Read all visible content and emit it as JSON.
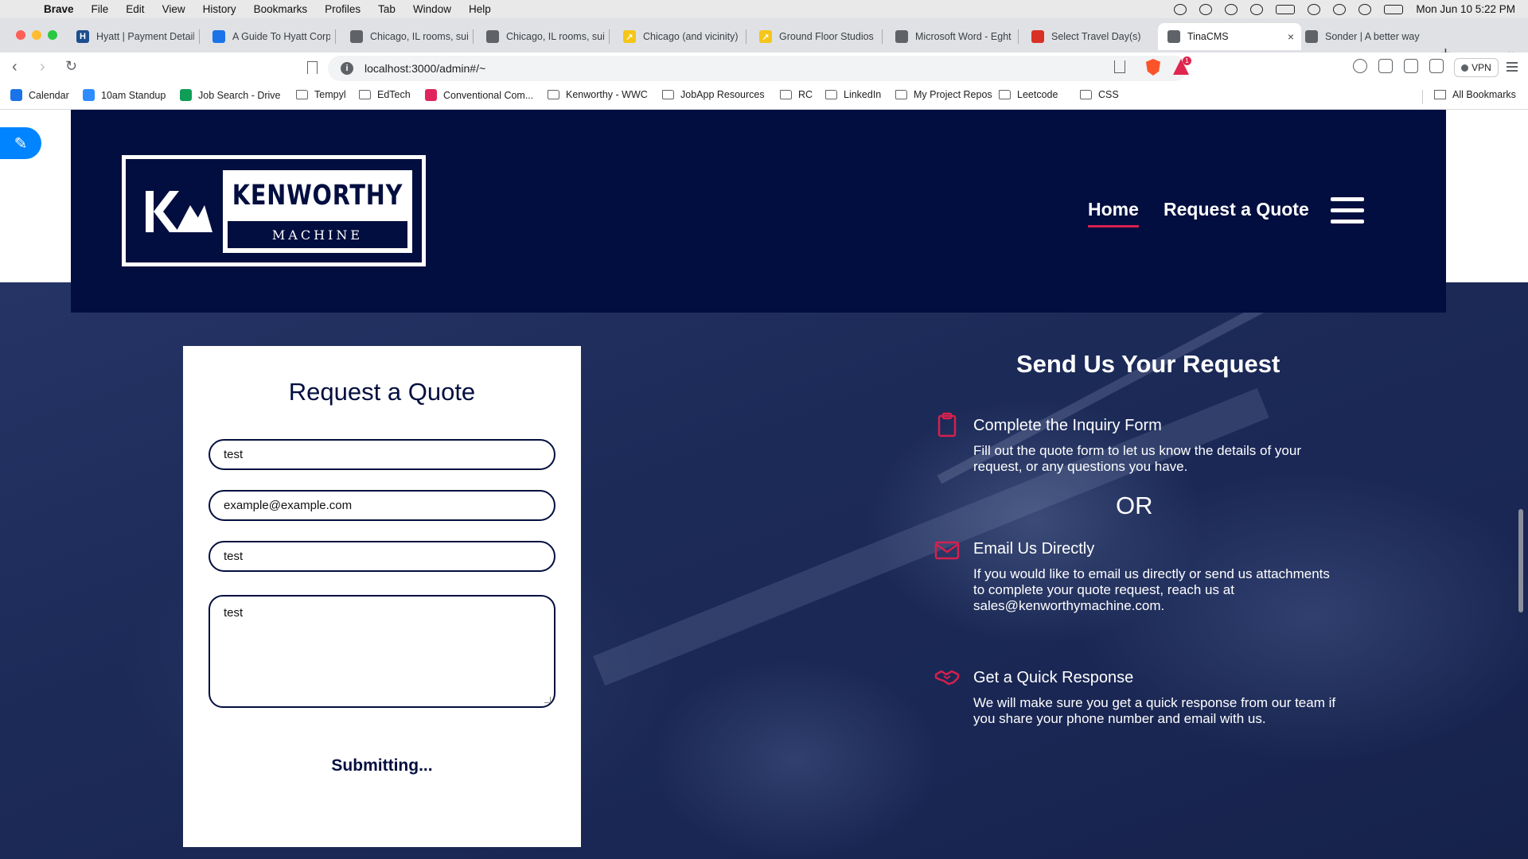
{
  "menubar": {
    "app": "Brave",
    "items": [
      "File",
      "Edit",
      "View",
      "History",
      "Bookmarks",
      "Profiles",
      "Tab",
      "Window",
      "Help"
    ],
    "clock": "Mon Jun 10  5:22 PM"
  },
  "tabs": [
    {
      "title": "Hyatt | Payment Detail",
      "fav": "H",
      "favColor": "#1c4e8c"
    },
    {
      "title": "A Guide To Hyatt Corp",
      "fav": "",
      "favColor": "#1a73e8"
    },
    {
      "title": "Chicago, IL rooms, sui",
      "fav": "",
      "favColor": "#5f6368"
    },
    {
      "title": "Chicago, IL rooms, sui",
      "fav": "",
      "favColor": "#5f6368"
    },
    {
      "title": "Chicago (and vicinity)",
      "fav": "↗",
      "favColor": "#f5c518"
    },
    {
      "title": "Ground Floor Studios",
      "fav": "↗",
      "favColor": "#f5c518"
    },
    {
      "title": "Microsoft Word - Eght",
      "fav": "",
      "favColor": "#5f6368"
    },
    {
      "title": "Select Travel Day(s)",
      "fav": "",
      "favColor": "#d93025"
    },
    {
      "title": "TinaCMS",
      "fav": "",
      "favColor": "#5f6368",
      "active": true
    },
    {
      "title": "Sonder | A better way",
      "fav": "",
      "favColor": "#5f6368"
    }
  ],
  "toolbar": {
    "url": "localhost:3000/admin#/~",
    "vpn_label": "VPN",
    "badge_count": "1"
  },
  "bookmarks": [
    "Calendar",
    "10am Standup",
    "Job Search - Drive",
    "Tempyl",
    "EdTech",
    "Conventional Com...",
    "Kenworthy - WWC",
    "JobApp Resources",
    "RC",
    "LinkedIn",
    "My Project Repos",
    "Leetcode",
    "CSS"
  ],
  "all_bookmarks": "All Bookmarks",
  "site": {
    "logo_word": "KENWORTHY",
    "logo_sub": "MACHINE",
    "nav": {
      "home": "Home",
      "quote": "Request a Quote"
    }
  },
  "form": {
    "title": "Request a Quote",
    "name_value": "test",
    "email_value": "example@example.com",
    "phone_value": "test",
    "message_value": "test",
    "submit_label": "Submitting..."
  },
  "info": {
    "title": "Send Us Your Request",
    "or_label": "OR",
    "steps": [
      {
        "title": "Complete the Inquiry Form",
        "desc": "Fill out the quote form to let us know the details of your request, or any questions you have."
      },
      {
        "title": "Email Us Directly",
        "desc": "If you would like to email us directly or send us attachments to complete your quote request, reach us at sales@kenworthymachine.com."
      },
      {
        "title": "Get a Quick Response",
        "desc": "We will make sure you get a quick response from our team if you share your phone number and email with us."
      }
    ]
  },
  "colors": {
    "navy": "#020e3f",
    "accent": "#d6204e",
    "brave_blue": "#0084ff"
  }
}
